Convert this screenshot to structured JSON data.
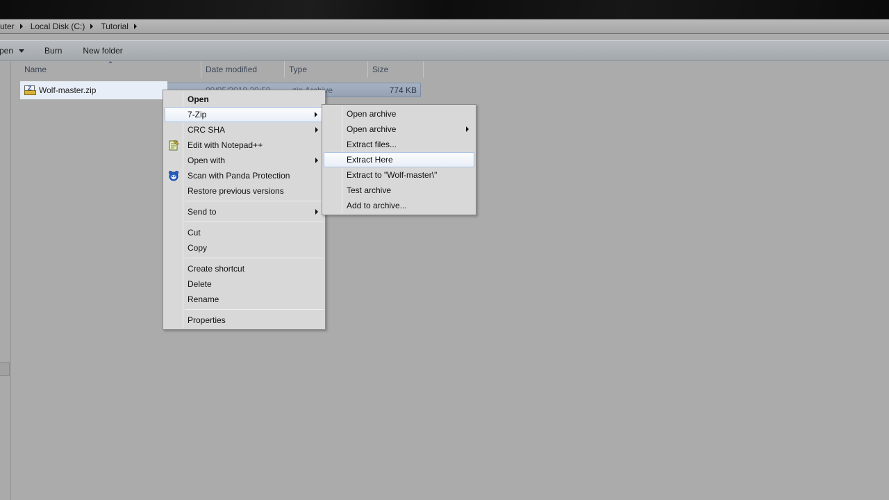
{
  "address": {
    "crumbs": [
      "uter",
      "Local Disk (C:)",
      "Tutorial"
    ]
  },
  "toolbar": {
    "open_label": "pen",
    "burn_label": "Burn",
    "new_folder_label": "New folder"
  },
  "columns": {
    "name": "Name",
    "date_modified": "Date modified",
    "type": "Type",
    "size": "Size"
  },
  "file": {
    "name": "Wolf-master.zip",
    "date_modified": "09/05/2018 20:50",
    "type": "zip Archive",
    "size": "774 KB"
  },
  "context_menu": {
    "open": "Open",
    "seven_zip": "7-Zip",
    "crc_sha": "CRC SHA",
    "edit_notepad": "Edit with Notepad++",
    "open_with": "Open with",
    "scan_panda": "Scan with Panda Protection",
    "restore": "Restore previous versions",
    "send_to": "Send to",
    "cut": "Cut",
    "copy": "Copy",
    "create_shortcut": "Create shortcut",
    "delete": "Delete",
    "rename": "Rename",
    "properties": "Properties"
  },
  "seven_zip_submenu": {
    "open_archive": "Open archive",
    "open_archive_more": "Open archive",
    "extract_files": "Extract files...",
    "extract_here": "Extract Here",
    "extract_to": "Extract to \"Wolf-master\\\"",
    "test_archive": "Test archive",
    "add_to_archive": "Add to archive..."
  },
  "icons": {
    "file": "zip-file-icon",
    "notepad": "notepad-plus-plus-icon",
    "panda": "panda-protection-icon"
  },
  "colors": {
    "highlight_border": "#a9c1e3",
    "selection": "#95a2b4"
  }
}
